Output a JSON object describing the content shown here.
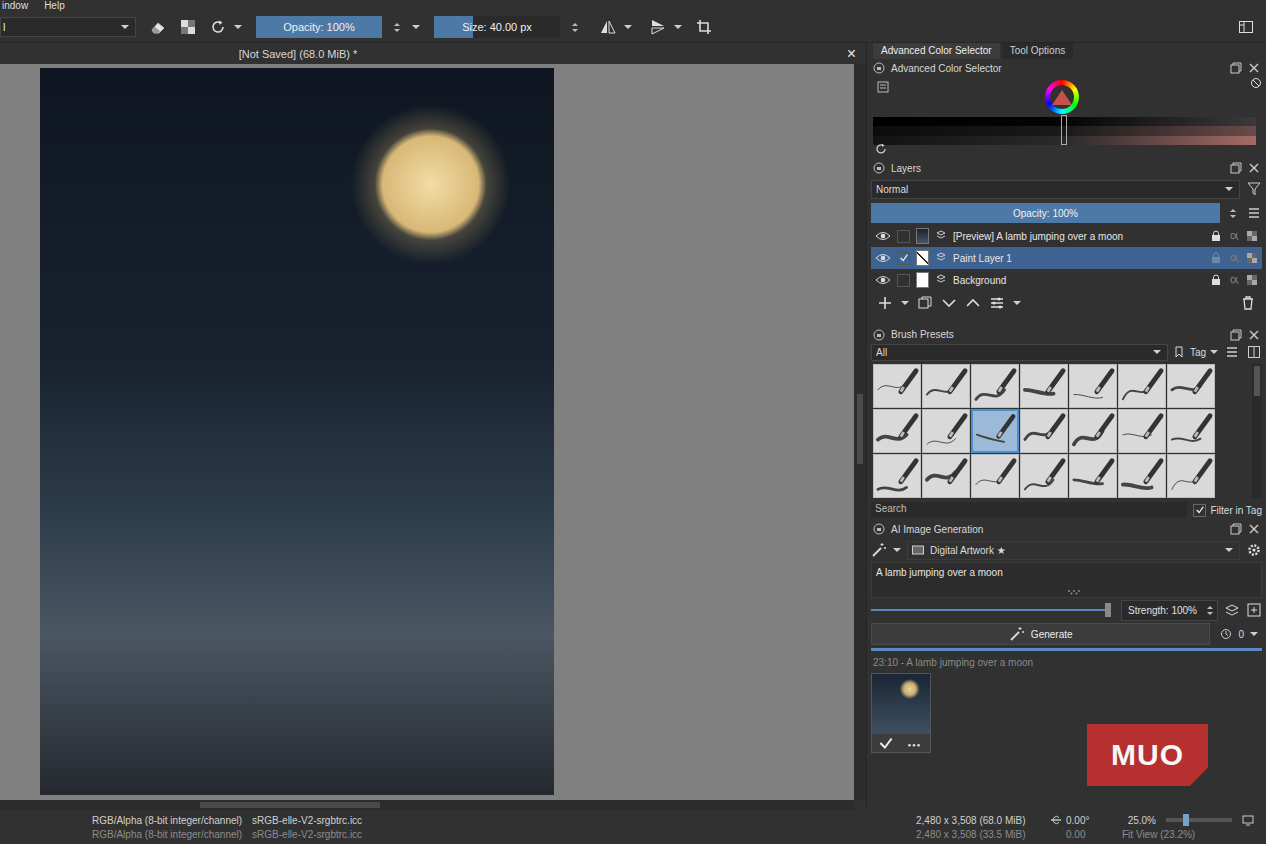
{
  "menu": [
    "indow",
    "Help"
  ],
  "toolbar": {
    "blend_mode": "l",
    "opacity": {
      "label": "Opacity: 100%",
      "level": 1
    },
    "size": {
      "label": "Size: 40.00 px",
      "level": 0.31
    }
  },
  "document": {
    "title": "[Not Saved] (68.0 MiB) *",
    "close": "×"
  },
  "dock_tabs": [
    {
      "label": "Advanced Color Selector",
      "selected": true
    },
    {
      "label": "Tool Options",
      "selected": false
    }
  ],
  "color_selector": {
    "title": "Advanced Color Selector"
  },
  "layers": {
    "title": "Layers",
    "blend_mode": "Normal",
    "opacity": {
      "label": "Opacity: 100%",
      "level": 1
    },
    "items": [
      {
        "name": "[Preview] A lamb jumping over a moon",
        "kind": "preview",
        "visible": true,
        "checked": false,
        "selected": false,
        "locked": true
      },
      {
        "name": "Paint Layer 1",
        "kind": "paint",
        "visible": true,
        "checked": true,
        "selected": true,
        "locked": false
      },
      {
        "name": "Background",
        "kind": "fill",
        "visible": true,
        "checked": false,
        "selected": false,
        "locked": true
      }
    ]
  },
  "brush_presets": {
    "title": "Brush Presets",
    "filter": "All",
    "tag": "Tag",
    "search_placeholder": "Search",
    "filter_in_tag": {
      "label": "Filter in Tag",
      "checked": true
    },
    "presets": [
      {
        "selected": false
      },
      {
        "selected": false
      },
      {
        "selected": false
      },
      {
        "selected": false
      },
      {
        "selected": false
      },
      {
        "selected": false
      },
      {
        "selected": false
      },
      {
        "selected": false
      },
      {
        "selected": false
      },
      {
        "selected": true
      },
      {
        "selected": false
      },
      {
        "selected": false
      },
      {
        "selected": false
      },
      {
        "selected": false
      },
      {
        "selected": false
      },
      {
        "selected": false
      },
      {
        "selected": false
      },
      {
        "selected": false
      },
      {
        "selected": false
      },
      {
        "selected": false
      },
      {
        "selected": false
      }
    ]
  },
  "ai_generation": {
    "title": "AI Image Generation",
    "style": "Digital Artwork ★",
    "prompt": "A lamb jumping over a moon",
    "strength": {
      "label": "Strength: 100%",
      "level": 1
    },
    "generate": "Generate",
    "queue_count": "0",
    "progress": 1,
    "history": [
      {
        "label": "23:10 - A lamb jumping over a moon"
      }
    ]
  },
  "watermark": "MUO",
  "status_bar": {
    "color_model": "RGB/Alpha (8-bit integer/channel)",
    "profile": "sRGB-elle-V2-srgbtrc.icc",
    "dimensions": "2,480 x 3,508 (68.0 MiB)",
    "rotation": "0.00°",
    "zoom": "25.0%",
    "zoom_level": 0.3,
    "ghost": {
      "color_model": "RGB/Alpha (8-bit integer/channel)",
      "profile": "sRGB-elle-V2-srgbtrc.icc",
      "dimensions": "2,480 x 3,508 (33.5 MiB)",
      "rotation": "0.00",
      "zoom": "Fit View (23.2%)"
    }
  }
}
